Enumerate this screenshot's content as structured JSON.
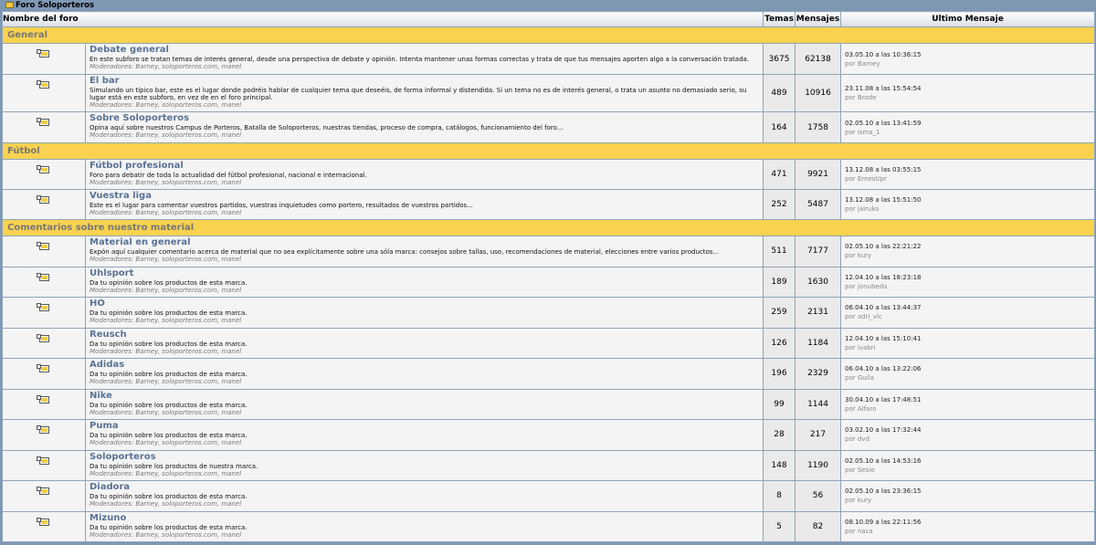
{
  "header_title": "Foro Soloporteros",
  "columns": {
    "name": "Nombre del foro",
    "topics": "Temas",
    "posts": "Mensajes",
    "last": "Ultimo Mensaje"
  },
  "moderators_label": "Moderadores:",
  "by_label": "por",
  "categories": [
    {
      "name": "General",
      "forums": [
        {
          "name": "Debate general",
          "desc": "En este subforo se tratan temas de interés general, desde una perspectiva de debate y opinión. Intenta mantener unas formas correctas y trata de que tus mensajes aporten algo a la conversación tratada.",
          "mods": [
            "Barney",
            "soloporteros.com",
            "manel"
          ],
          "topics": "3675",
          "posts": "62138",
          "last_date": "03.05.10 a las 10:36:15",
          "last_user": "Barney"
        },
        {
          "name": "El bar",
          "desc": "Simulando un típico bar, este es el lugar donde podréis hablar de cualquier tema que deseéis, de forma informal y distendida. Si un tema no es de interés general, o trata un asunto no demasiado serio, su lugar está en este subforo, en vez de en el foro principal.",
          "mods": [
            "Barney",
            "soloporteros.com",
            "manel"
          ],
          "topics": "489",
          "posts": "10916",
          "last_date": "23.11.08 a las 15:54:54",
          "last_user": "Brode"
        },
        {
          "name": "Sobre Soloporteros",
          "desc": "Opina aquí sobre nuestros Campus de Porteros, Batalla de Soloporteros, nuestras tiendas, proceso de compra, catálogos, funcionamiento del foro...",
          "mods": [
            "Barney",
            "soloporteros.com",
            "manel"
          ],
          "topics": "164",
          "posts": "1758",
          "last_date": "02.05.10 a las 13:41:59",
          "last_user": "isma_1"
        }
      ]
    },
    {
      "name": "Fútbol",
      "forums": [
        {
          "name": "Fútbol profesional",
          "desc": "Foro para debatir de toda la actualidad del fútbol profesional, nacional e internacional.",
          "mods": [
            "Barney",
            "soloporteros.com",
            "manel"
          ],
          "topics": "471",
          "posts": "9921",
          "last_date": "13.12.08 a las 03:55:15",
          "last_user": "Ernest/pr"
        },
        {
          "name": "Vuestra liga",
          "desc": "Este es el lugar para comentar vuestros partidos, vuestras inquietudes como portero, resultados de vuestros partidos...",
          "mods": [
            "Barney",
            "soloporteros.com",
            "manel"
          ],
          "topics": "252",
          "posts": "5487",
          "last_date": "13.12.08 a las 15:51:50",
          "last_user": "jairuko"
        }
      ]
    },
    {
      "name": "Comentarios sobre nuestro material",
      "forums": [
        {
          "name": "Material en general",
          "desc": "Expón aquí cualquier comentario acerca de material que no sea explícitamente sobre una sóla marca: consejos sobre tallas, uso, recomendaciones de material, elecciones entre varios productos...",
          "mods": [
            "Barney",
            "soloporteros.com",
            "manel"
          ],
          "topics": "511",
          "posts": "7177",
          "last_date": "02.05.10 a las 22:21:22",
          "last_user": "kury"
        },
        {
          "name": "Uhlsport",
          "desc": "Da tu opinión sobre los productos de esta marca.",
          "mods": [
            "Barney",
            "soloporteros.com",
            "manel"
          ],
          "topics": "189",
          "posts": "1630",
          "last_date": "12.04.10 a las 18:23:18",
          "last_user": "jonubeda"
        },
        {
          "name": "HO",
          "desc": "Da tu opinión sobre los productos de esta marca.",
          "mods": [
            "Barney",
            "soloporteros.com",
            "manel"
          ],
          "topics": "259",
          "posts": "2131",
          "last_date": "06.04.10 a las 13:44:37",
          "last_user": "adri_vlc"
        },
        {
          "name": "Reusch",
          "desc": "Da tu opinión sobre los productos de esta marca.",
          "mods": [
            "Barney",
            "soloporteros.com",
            "manel"
          ],
          "topics": "126",
          "posts": "1184",
          "last_date": "12.04.10 a las 15:10:41",
          "last_user": "ivabri"
        },
        {
          "name": "Adidas",
          "desc": "Da tu opinión sobre los productos de esta marca.",
          "mods": [
            "Barney",
            "soloporteros.com",
            "manel"
          ],
          "topics": "196",
          "posts": "2329",
          "last_date": "06.04.10 a las 13:22:06",
          "last_user": "Guila"
        },
        {
          "name": "Nike",
          "desc": "Da tu opinión sobre los productos de esta marca.",
          "mods": [
            "Barney",
            "soloporteros.com",
            "manel"
          ],
          "topics": "99",
          "posts": "1144",
          "last_date": "30.04.10 a las 17:48:51",
          "last_user": "Alfaro"
        },
        {
          "name": "Puma",
          "desc": "Da tu opinión sobre los productos de esta marca.",
          "mods": [
            "Barney",
            "soloporteros.com",
            "manel"
          ],
          "topics": "28",
          "posts": "217",
          "last_date": "03.02.10 a las 17:32:44",
          "last_user": "dvd"
        },
        {
          "name": "Soloporteros",
          "desc": "Da tu opinión sobre los productos de nuestra marca.",
          "mods": [
            "Barney",
            "soloporteros.com",
            "manel"
          ],
          "topics": "148",
          "posts": "1190",
          "last_date": "02.05.10 a las 14:53:16",
          "last_user": "Sesio"
        },
        {
          "name": "Diadora",
          "desc": "Da tu opinión sobre los productos de esta marca.",
          "mods": [
            "Barney",
            "soloporteros.com",
            "manel"
          ],
          "topics": "8",
          "posts": "56",
          "last_date": "02.05.10 a las 23:36:15",
          "last_user": "kury"
        },
        {
          "name": "Mizuno",
          "desc": "Da tu opinión sobre los productos de esta marca.",
          "mods": [
            "Barney",
            "soloporteros.com",
            "manel"
          ],
          "topics": "5",
          "posts": "82",
          "last_date": "08.10.09 a las 22:11:56",
          "last_user": "naca"
        }
      ]
    }
  ]
}
